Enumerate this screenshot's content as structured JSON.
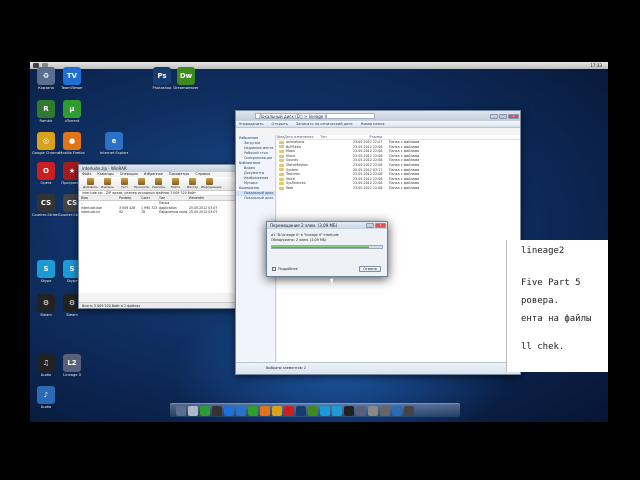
{
  "menubar": {
    "clock": "17:33"
  },
  "desktop_icons": [
    {
      "label": "Корзина",
      "color": "#5a6f8f",
      "glyph": "♻"
    },
    {
      "label": "TeamViewer",
      "color": "#1f6fd6",
      "glyph": "TV"
    },
    {
      "label": "Photoshop",
      "color": "#163c72",
      "glyph": "Ps"
    },
    {
      "label": "Dreamweaver",
      "color": "#3f8a1f",
      "glyph": "Dw"
    },
    {
      "label": "Ramblr",
      "color": "#2f7a2f",
      "glyph": "R"
    },
    {
      "label": "uTorrent",
      "color": "#2f9c2f",
      "glyph": "µ"
    },
    {
      "label": "Google Chrome",
      "color": "#d9a21b",
      "glyph": "◎"
    },
    {
      "label": "Mozilla Firefox",
      "color": "#e27418",
      "glyph": "●"
    },
    {
      "label": "Internet Explorer",
      "color": "#2a72c9",
      "glyph": "e"
    },
    {
      "label": "Opera",
      "color": "#cc1f1f",
      "glyph": "O"
    },
    {
      "label": "Программа",
      "color": "#a41c1c",
      "glyph": "★"
    },
    {
      "label": "Counter-Strike 1.6",
      "color": "#333",
      "glyph": "CS"
    },
    {
      "label": "Counter-Strike Source",
      "color": "#444",
      "glyph": "CS"
    },
    {
      "label": "Skype",
      "color": "#1b9ad6",
      "glyph": "S"
    },
    {
      "label": "Skype",
      "color": "#1b9ad6",
      "glyph": "S"
    },
    {
      "label": "Steam",
      "color": "#222",
      "glyph": "⚙"
    },
    {
      "label": "Steam",
      "color": "#222",
      "glyph": "⚙"
    },
    {
      "label": "Lineage II",
      "color": "#59607a",
      "glyph": "L2"
    },
    {
      "label": "Audio",
      "color": "#222",
      "glyph": "♫"
    },
    {
      "label": "Audio",
      "color": "#2c6ab5",
      "glyph": "♪"
    }
  ],
  "explorer": {
    "title": "Локальный диск (D:) > lineage II",
    "toolbar": [
      "Упорядочить",
      "Открыть",
      "Записать на оптический диск",
      "Новая папка"
    ],
    "sidebar": [
      {
        "label": "Избранное",
        "header": true
      },
      {
        "label": "Загрузки"
      },
      {
        "label": "Недавние места"
      },
      {
        "label": "Рабочий стол"
      },
      {
        "label": "Синхронизация"
      },
      {
        "label": "Библиотеки",
        "header": true
      },
      {
        "label": "Видео"
      },
      {
        "label": "Документы"
      },
      {
        "label": "Изображения"
      },
      {
        "label": "Музыка"
      },
      {
        "label": "Компьютер",
        "header": true
      },
      {
        "label": "Локальный диск (C:)",
        "selected": true
      },
      {
        "label": "Локальный диск (D:)"
      }
    ],
    "columns": [
      "Имя",
      "Дата изменения",
      "Тип",
      "Размер"
    ],
    "rows": [
      {
        "name": "animations",
        "date": "23.05.2012 22:07",
        "type": "Папка с файлами",
        "size": ""
      },
      {
        "name": "BuffSkills",
        "date": "23.05.2012 22:08",
        "type": "Папка с файлами",
        "size": ""
      },
      {
        "name": "Maps",
        "date": "23.05.2012 22:08",
        "type": "Папка с файлами",
        "size": ""
      },
      {
        "name": "Music",
        "date": "23.05.2012 22:08",
        "type": "Папка с файлами",
        "size": ""
      },
      {
        "name": "Sounds",
        "date": "23.05.2012 22:08",
        "type": "Папка с файлами",
        "size": ""
      },
      {
        "name": "StaticMeshes",
        "date": "23.05.2012 22:08",
        "type": "Папка с файлами",
        "size": ""
      },
      {
        "name": "System",
        "date": "25.05.2012 03:17",
        "type": "Папка с файлами",
        "size": ""
      },
      {
        "name": "Textures",
        "date": "23.05.2012 22:08",
        "type": "Папка с файлами",
        "size": ""
      },
      {
        "name": "Voice",
        "date": "23.05.2012 22:08",
        "type": "Папка с файлами",
        "size": ""
      },
      {
        "name": "SysTextures",
        "date": "23.05.2012 22:08",
        "type": "Папка с файлами",
        "size": ""
      },
      {
        "name": "Web",
        "date": "23.05.2012 22:08",
        "type": "Папка с файлами",
        "size": ""
      }
    ],
    "status": "Выбрано элементов: 2"
  },
  "winrar": {
    "title": "interlude.zip - WinRAR",
    "menu": [
      "Файл",
      "Команды",
      "Операции",
      "Избранное",
      "Параметры",
      "Справка"
    ],
    "tools": [
      "Добавить",
      "Извлечь",
      "Тест",
      "Просмотр",
      "Удалить",
      "Найти",
      "Мастер",
      "Информация"
    ],
    "path": "interlude.zip - ZIP архив, размер исходных файлов 3 009 520 байт",
    "columns": [
      "Имя",
      "Размер",
      "Сжат",
      "Тип",
      "Изменён"
    ],
    "rows": [
      {
        "name": "..",
        "size": "",
        "packed": "",
        "type": "Папка",
        "date": ""
      },
      {
        "name": "interlude.exe",
        "size": "3 009 428",
        "packed": "1 990 723",
        "type": "Application",
        "date": "25.05.2012 03:07"
      },
      {
        "name": "interlude.ini",
        "size": "92",
        "packed": "78",
        "type": "Параметры конф.",
        "date": "25.05.2012 03:07"
      }
    ],
    "status": "Всего: 3 009 520 байт в 2 файлах"
  },
  "dialog": {
    "title": "Перемещение 2 элем. (3,09 МБ)",
    "line1": "из \"D:\\lineage II\" в \"lineage II\" Interlude",
    "line2": "Обнаружено: 2 элем. (3,09 МБ)",
    "progress": 0.88,
    "details": "Подробнее",
    "cancel": "Отмена"
  },
  "terminal": {
    "lines": [
      "lineage2",
      "Five Part 5",
      "ровера.",
      "ента на файлы",
      "ll chek."
    ]
  },
  "dock": {
    "icons": [
      "#5a6f8f",
      "#b0b8c8",
      "#2f9c2f",
      "#333",
      "#1f6fd6",
      "#2a72c9",
      "#2f9c2f",
      "#e27418",
      "#d9a21b",
      "#cc1f1f",
      "#163c72",
      "#3f8a1f",
      "#1b9ad6",
      "#1b9ad6",
      "#222",
      "#59607a",
      "#888",
      "#666",
      "#2c6ab5",
      "#444"
    ]
  }
}
